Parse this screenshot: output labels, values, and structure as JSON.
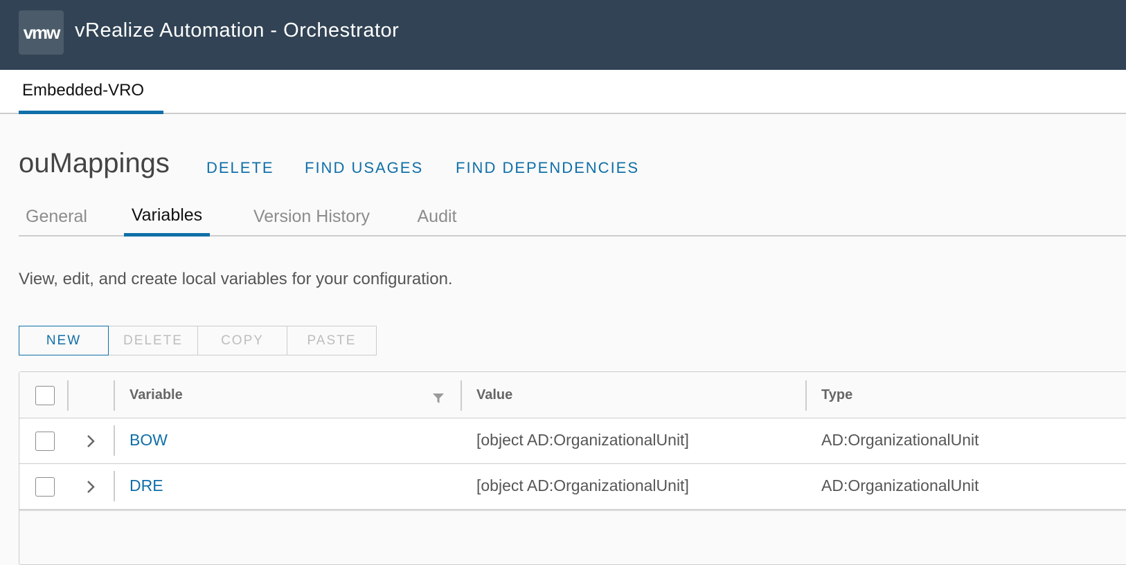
{
  "header": {
    "logo_text": "vmw",
    "app_title": "vRealize Automation - Orchestrator"
  },
  "subnav": {
    "active_tab": "Embedded-VRO"
  },
  "page": {
    "title": "ouMappings",
    "actions": {
      "delete": "DELETE",
      "find_usages": "FIND USAGES",
      "find_dependencies": "FIND DEPENDENCIES"
    }
  },
  "tabs": [
    {
      "label": "General",
      "active": false
    },
    {
      "label": "Variables",
      "active": true
    },
    {
      "label": "Version History",
      "active": false
    },
    {
      "label": "Audit",
      "active": false
    }
  ],
  "description": "View, edit, and create local variables for your configuration.",
  "toolbar": {
    "new": "NEW",
    "delete": "DELETE",
    "copy": "COPY",
    "paste": "PASTE"
  },
  "grid": {
    "columns": {
      "variable": "Variable",
      "value": "Value",
      "type": "Type"
    },
    "rows": [
      {
        "variable": "BOW",
        "value": "[object AD:OrganizationalUnit]",
        "type": "AD:OrganizationalUnit"
      },
      {
        "variable": "DRE",
        "value": "[object AD:OrganizationalUnit]",
        "type": "AD:OrganizationalUnit"
      }
    ]
  },
  "colors": {
    "header_bg": "#314354",
    "accent": "#0f6fa8",
    "page_bg": "#fafafa"
  },
  "icons": [
    "vmw-logo",
    "filter-icon",
    "chevron-right-icon"
  ]
}
